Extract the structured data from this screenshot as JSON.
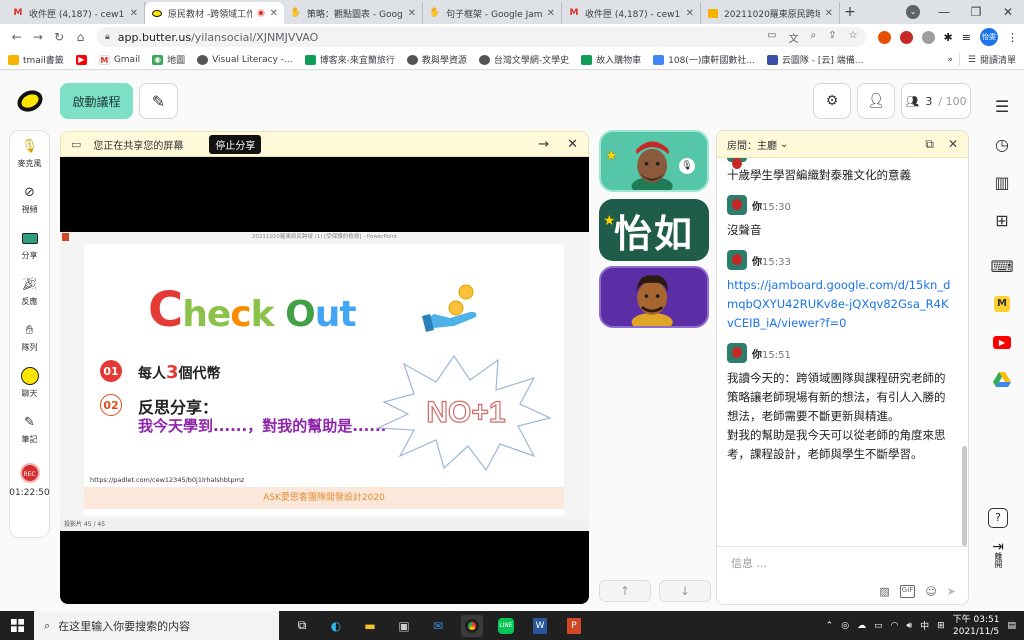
{
  "browser": {
    "tabs": [
      {
        "title": "收件匣 (4,187) - cew12...",
        "icon": "gmail-icon",
        "active": false
      },
      {
        "title": "原民教材 -跨領域工作",
        "icon": "butter-icon",
        "active": true
      },
      {
        "title": "策略：觀點圖表 - Goog",
        "icon": "hand-icon",
        "active": false
      },
      {
        "title": "句子框架 - Google Jam",
        "icon": "hand-icon",
        "active": false
      },
      {
        "title": "收件匣 (4,187) - cew12...",
        "icon": "gmail-icon",
        "active": false
      },
      {
        "title": "20211020羅東原民跨域",
        "icon": "slides-icon",
        "active": false
      }
    ],
    "url_host": "app.butter.us",
    "url_path": "/yilansocial/XJNMJVVAO",
    "profile_label": "怡雯",
    "bookmarks": [
      {
        "label": "tmail書籤",
        "color": "#f4b400"
      },
      {
        "label": "",
        "color": "#ff0000"
      },
      {
        "label": "Gmail",
        "color": "#d93025"
      },
      {
        "label": "地圖",
        "color": "#34a853"
      },
      {
        "label": "Visual Literacy -...",
        "color": "#555555"
      },
      {
        "label": "博客來-來宜蘭旅行",
        "color": "#0f9d58"
      },
      {
        "label": "教與學資源",
        "color": "#555555"
      },
      {
        "label": "台灣文學網-文學史",
        "color": "#555555"
      },
      {
        "label": "故入購物車",
        "color": "#0f9d58"
      },
      {
        "label": "108(一)康軒國數社...",
        "color": "#4285f4"
      },
      {
        "label": "云圖隊 - [云] 端備...",
        "color": "#3c4ea8"
      }
    ],
    "bookmark_more": "»",
    "reading_list": "閱讀清單"
  },
  "app": {
    "start_label": "啟動議程",
    "participants_count": "3",
    "participants_max": "/ 100",
    "left_bar": [
      {
        "label": "麥克風",
        "icon": "microphone-icon"
      },
      {
        "label": "視頻",
        "icon": "camera-off-icon"
      },
      {
        "label": "分享",
        "icon": "share-screen-icon"
      },
      {
        "label": "反應",
        "icon": "reaction-icon"
      },
      {
        "label": "隊列",
        "icon": "raise-hand-icon"
      },
      {
        "label": "聊天",
        "icon": "chat-icon"
      },
      {
        "label": "筆記",
        "icon": "notes-icon"
      }
    ],
    "rec_label": "REC",
    "timer": "01:22:50",
    "share_bar": {
      "text": "您正在共享您的屏幕",
      "stop_label": "停止分享"
    },
    "ppt": {
      "window_title": "20211020羅東原民跨域 (1) [受保護的檢視] - PowerPoint",
      "heading_parts": [
        "C",
        "heck ",
        "O",
        "ut"
      ],
      "point1_prefix": "每人",
      "point1_number": "3",
      "point1_suffix": "個代幣",
      "point2": "反思分享：",
      "point3": "我今天學到......，對我的幫助是......",
      "burst_text": "NO+1",
      "badge1": "01",
      "badge2": "02",
      "padlet_url": "https://padlet.com/cew12345/b0j1lrhalshbtpmz",
      "footer": "ASK愛思客團隊開發設計2020",
      "status": "投影片 45 / 45"
    },
    "avatar_text": "怡如",
    "chat": {
      "room_label": "房間：主廳",
      "first_text": "十歲學生學習編織對泰雅文化的意義",
      "messages": [
        {
          "name": "你",
          "time": "15:30",
          "text": "沒聲音",
          "is_link": false
        },
        {
          "name": "你",
          "time": "15:33",
          "text": "https://jamboard.google.com/d/15kn_dmqbQXYU42RUKv8e-jQXqv82Gsa_R4KvCEIB_iA/viewer?f=0",
          "is_link": true
        },
        {
          "name": "你",
          "time": "15:51",
          "text": "我讀今天的：跨領域團隊與課程研究老師的策略讓老師現場有新的想法，有引人入勝的想法，老師需要不斷更新與精進。\n對我的幫助是我今天可以從老師的角度來思考，課程設計，老師與學生不斷學習。",
          "is_link": false
        }
      ],
      "input_placeholder": "信息 ...",
      "gif_label": "GIF"
    },
    "right_rail_leave": "離開"
  },
  "taskbar": {
    "search_placeholder": "在这里输入你要搜索的内容",
    "ime": "中",
    "time": "下午 03:51",
    "date": "2021/11/5"
  }
}
